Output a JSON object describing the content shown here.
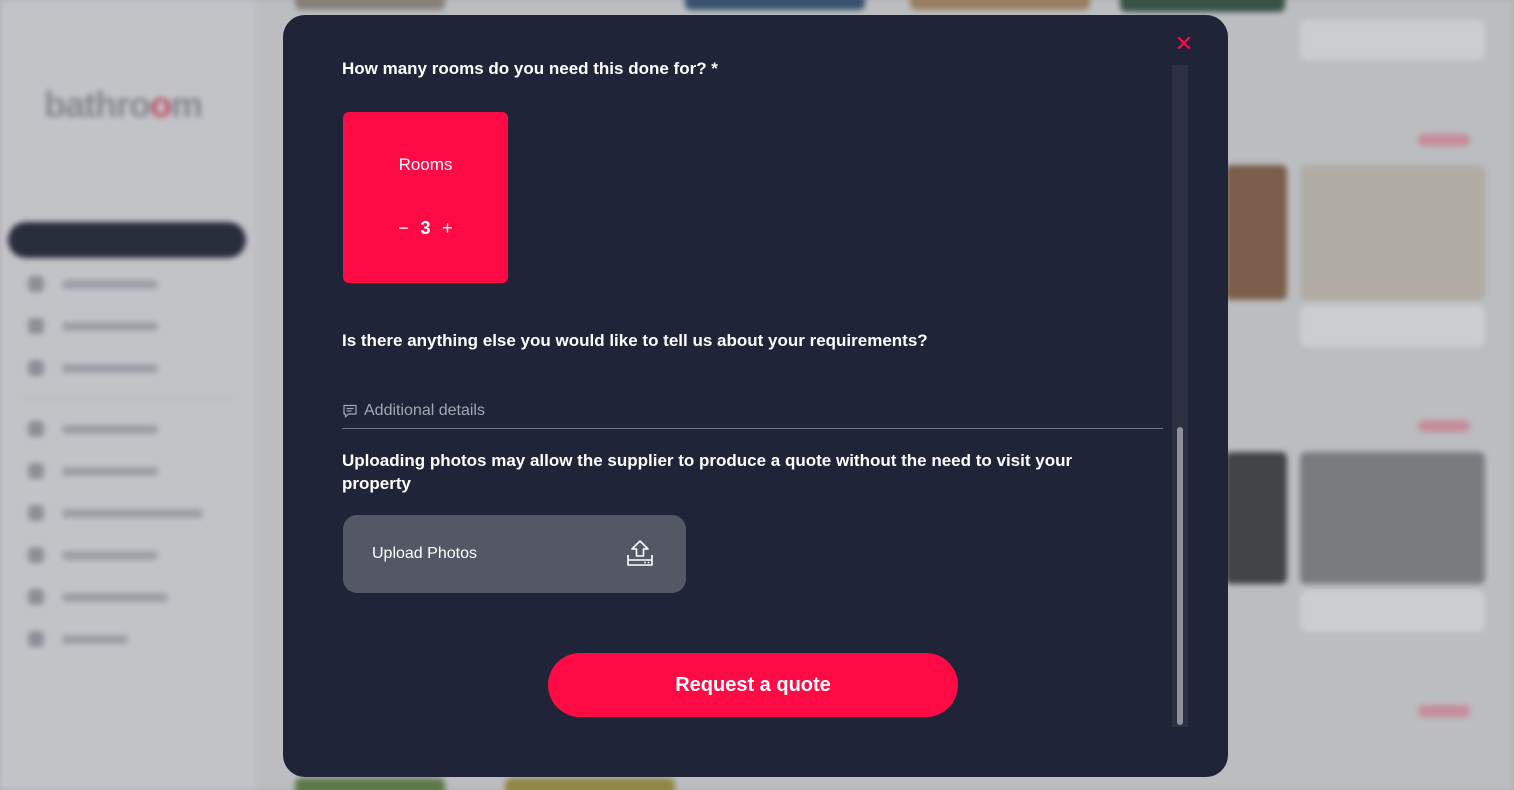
{
  "colors": {
    "accent": "#ff0a45",
    "modal_bg": "#1f2439",
    "upload_bg": "#545865",
    "text": "#ffffff",
    "muted": "#a4a7b3"
  },
  "modal": {
    "close_icon": "close-icon",
    "rooms_question": "How many rooms do you need this done for? *",
    "rooms": {
      "label": "Rooms",
      "decrement": "−",
      "value": "3",
      "increment": "+"
    },
    "requirements_question": "Is there anything else you would like to tell us about your requirements?",
    "details": {
      "placeholder": "Additional details",
      "icon": "comment-icon"
    },
    "upload_note": "Uploading photos may allow the supplier to produce a quote without the need to visit your property",
    "upload": {
      "label": "Upload Photos",
      "icon": "upload-icon"
    },
    "submit_label": "Request a quote"
  }
}
